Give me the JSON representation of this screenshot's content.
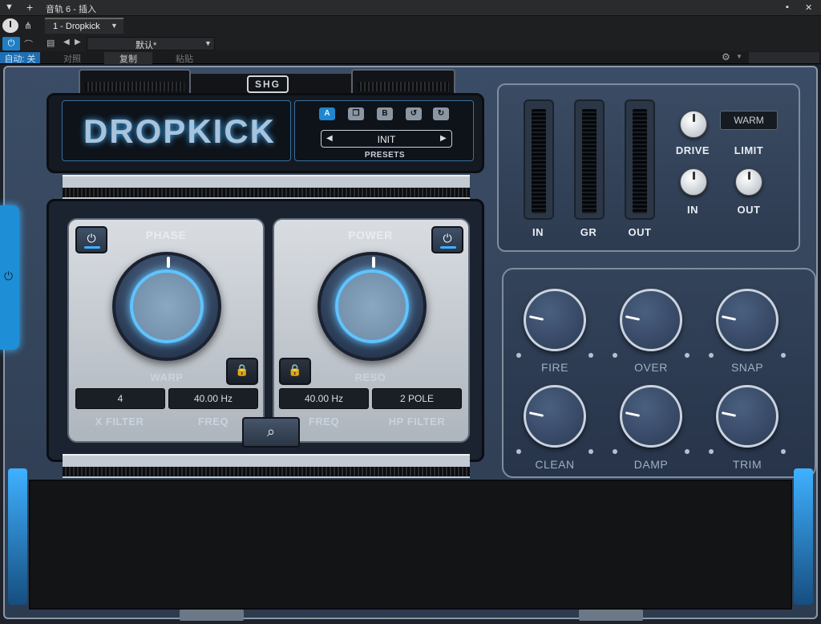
{
  "host": {
    "title": "音轨 6 - 插入",
    "collapse_icon": "▼",
    "add_icon": "+",
    "pin_icon": "▪",
    "close_icon": "✕",
    "plugin_slot": "1 - Dropkick",
    "preset": "默认*",
    "auto_label": "自动: 关",
    "compare_label": "对照",
    "copy_label": "复制",
    "paste_label": "粘贴"
  },
  "plugin": {
    "title": "DROPKICK",
    "logo": "SHG",
    "preset_buttons": [
      "A",
      "",
      "B",
      "↺",
      "↻"
    ],
    "preset_name": "INIT",
    "presets_label": "PRESETS",
    "warm_label": "WARM",
    "meters": [
      "IN",
      "GR",
      "OUT"
    ],
    "drive_label": "DRIVE",
    "limit_label": "LIMIT",
    "in_label": "IN",
    "out_label": "OUT",
    "phase_label": "PHASE",
    "power_label": "POWER",
    "warp_label": "WARP",
    "reso_label": "RESO",
    "x_filter_value": "4",
    "freq1_value": "40.00 Hz",
    "freq2_value": "40.00 Hz",
    "hp_value": "2 POLE",
    "x_filter_label": "X FILTER",
    "freq1_label": "FREQ",
    "freq2_label": "FREQ",
    "hp_filter_label": "HP FILTER",
    "knobs": [
      "FIRE",
      "OVER",
      "SNAP",
      "CLEAN",
      "DAMP",
      "TRIM"
    ]
  },
  "colors": {
    "accent": "#3fb1ff",
    "frame": "#3b4d66",
    "background": "#1b1c1e"
  }
}
